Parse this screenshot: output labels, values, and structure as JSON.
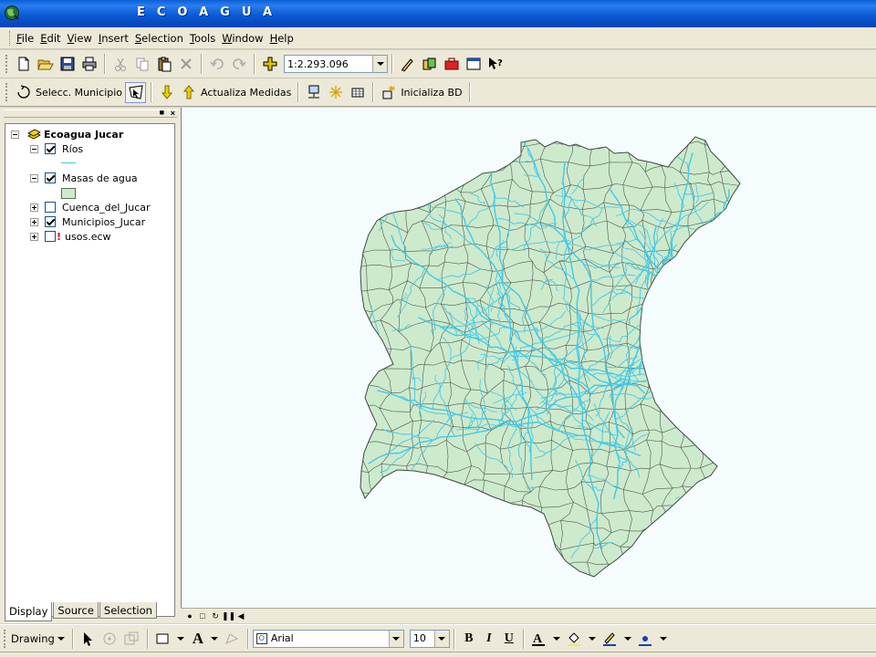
{
  "window": {
    "title": "ECOAGUA"
  },
  "menu": [
    "File",
    "Edit",
    "View",
    "Insert",
    "Selection",
    "Tools",
    "Window",
    "Help"
  ],
  "toolbar": {
    "scale_value": "1:2.293.096"
  },
  "ecoagua_toolbar": {
    "select_municipio": "Selecc. Municipio",
    "actualiza_medidas": "Actualiza Medidas",
    "inicializa_bd": "Inicializa BD"
  },
  "toc": {
    "dataframe": "Ecoagua Jucar",
    "layers": [
      {
        "name": "Ríos",
        "checked": true,
        "expanded": true
      },
      {
        "name": "Masas de agua",
        "checked": true,
        "expanded": true
      },
      {
        "name": "Cuenca_del_Jucar",
        "checked": false,
        "expanded": false
      },
      {
        "name": "Municipios_Jucar",
        "checked": true,
        "expanded": false
      },
      {
        "name": "usos.ecw",
        "checked": false,
        "expanded": false,
        "broken": true
      }
    ],
    "tabs": [
      "Display",
      "Source",
      "Selection"
    ]
  },
  "drawing": {
    "label": "Drawing",
    "font_name": "Arial",
    "font_size": "10",
    "bold": "B",
    "italic": "I",
    "underline": "U",
    "text_tool": "A"
  },
  "colors": {
    "rivers": "#42c9e6",
    "water_bodies": "#cdeacd",
    "map_background": "#f5fcfe"
  }
}
